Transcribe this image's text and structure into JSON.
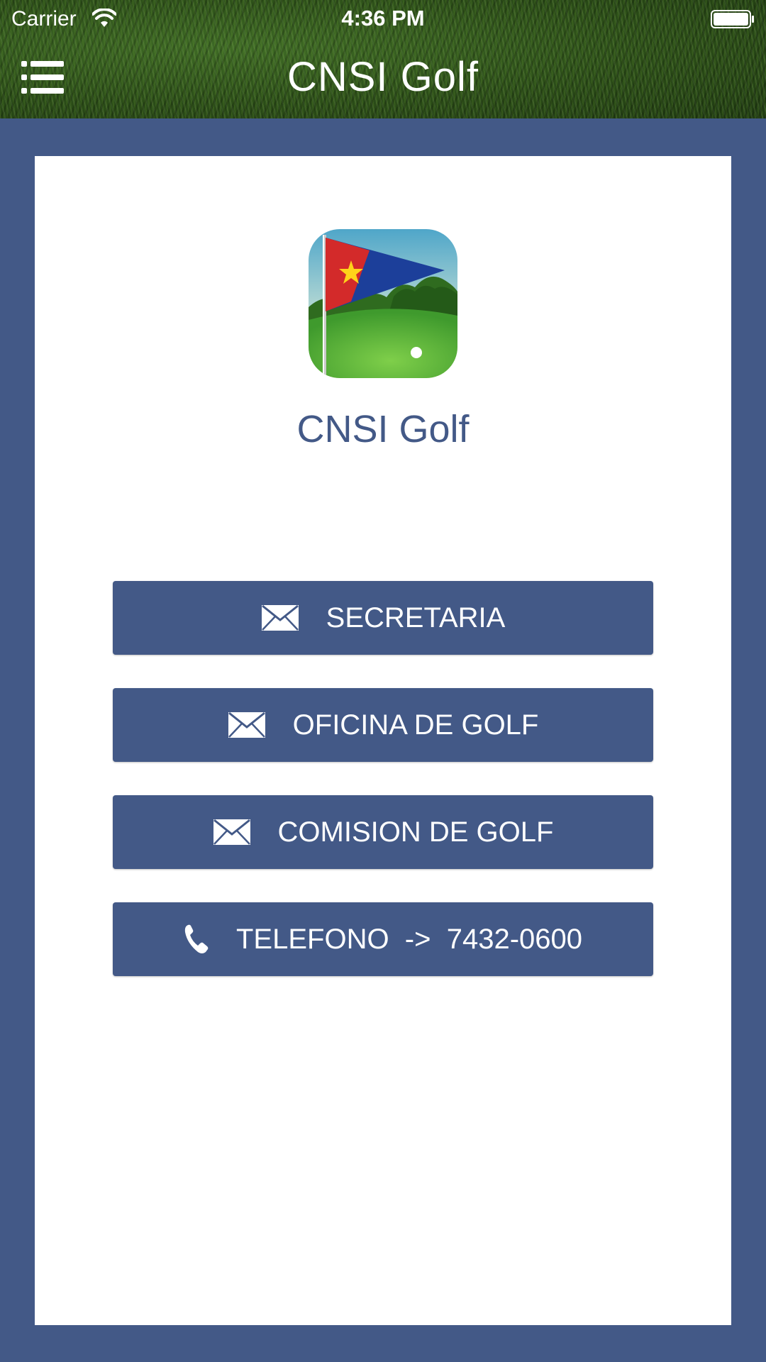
{
  "status_bar": {
    "carrier": "Carrier",
    "time": "4:36 PM",
    "wifi_icon": "wifi-icon",
    "battery_icon": "battery-icon"
  },
  "nav": {
    "title": "CNSI Golf",
    "menu_icon": "menu-icon"
  },
  "app": {
    "name": "CNSI Golf",
    "logo": "golf-flag-logo"
  },
  "buttons": [
    {
      "label": "SECRETARIA",
      "icon": "mail-icon"
    },
    {
      "label": "OFICINA DE GOLF",
      "icon": "mail-icon"
    },
    {
      "label": "COMISION DE GOLF",
      "icon": "mail-icon"
    },
    {
      "label": "TELEFONO  ->  7432-0600",
      "icon": "phone-icon"
    }
  ],
  "colors": {
    "brand": "#435987",
    "card": "#ffffff",
    "grass": "#2f5a1c"
  }
}
